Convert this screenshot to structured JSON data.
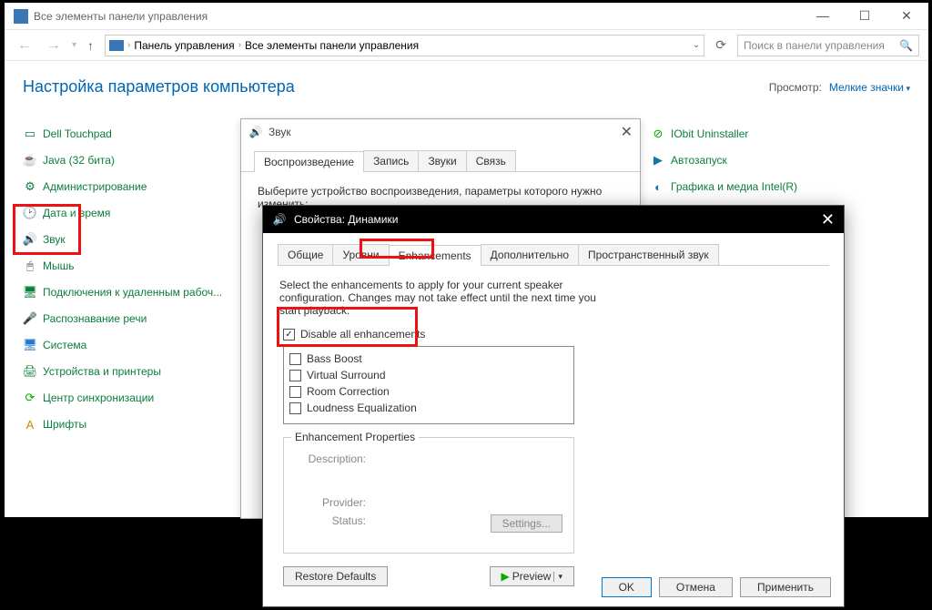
{
  "cp": {
    "title": "Все элементы панели управления",
    "address": {
      "root": "Панель управления",
      "section": "Все элементы панели управления"
    },
    "search_placeholder": "Поиск в панели управления",
    "heading": "Настройка параметров компьютера",
    "view_label": "Просмотр:",
    "view_mode": "Мелкие значки",
    "left_items": [
      "Dell Touchpad",
      "Java (32 бита)",
      "Администрирование",
      "Дата и время",
      "Звук",
      "Мышь",
      "Подключения к удаленным рабоч...",
      "Распознавание речи",
      "Система",
      "Устройства и принтеры",
      "Центр синхронизации",
      "Шрифты"
    ],
    "right_items": [
      "IObit Uninstaller",
      "Автозапуск",
      "Графика и медиа Intel(R)"
    ]
  },
  "sound": {
    "title": "Звук",
    "tabs": [
      "Воспроизведение",
      "Запись",
      "Звуки",
      "Связь"
    ],
    "instruction": "Выберите устройство воспроизведения, параметры которого нужно изменить:"
  },
  "props": {
    "title": "Свойства: Динамики",
    "tabs": [
      "Общие",
      "Уровни",
      "Enhancements",
      "Дополнительно",
      "Пространственный звук"
    ],
    "active_tab": 2,
    "instruction": "Select the enhancements to apply for your current speaker configuration. Changes may not take effect until the next time you start playback.",
    "disable_all": "Disable all enhancements",
    "enh_list": [
      "Bass Boost",
      "Virtual Surround",
      "Room Correction",
      "Loudness Equalization"
    ],
    "enh_props_label": "Enhancement Properties",
    "desc_label": "Description:",
    "provider_label": "Provider:",
    "status_label": "Status:",
    "settings_btn": "Settings...",
    "restore_btn": "Restore Defaults",
    "preview_btn": "Preview",
    "ok": "OK",
    "cancel": "Отмена",
    "apply": "Применить"
  }
}
